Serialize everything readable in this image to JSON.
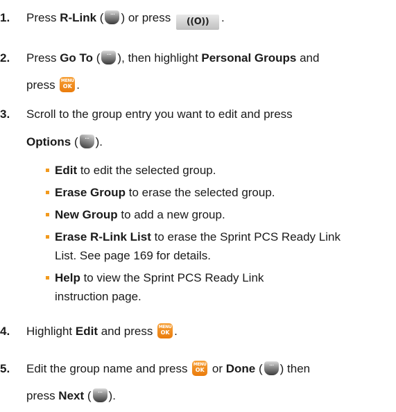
{
  "steps": [
    {
      "number": "1.",
      "text_a": "Press ",
      "bold_a": "R-Link",
      "text_b": " (",
      "text_c": ") or press ",
      "text_d": "."
    },
    {
      "number": "2.",
      "text_a": "Press ",
      "bold_a": "Go To",
      "text_b": " (",
      "text_c": "), then highlight ",
      "bold_b": "Personal Groups",
      "text_d": " and",
      "line2": "press ",
      "text_e": "."
    },
    {
      "number": "3.",
      "text_a": "Scroll to the group entry you want to edit and press",
      "bold_a": "Options",
      "text_b": " (",
      "text_c": ")."
    },
    {
      "number": "4.",
      "text_a": "Highlight ",
      "bold_a": "Edit",
      "text_b": " and press ",
      "text_c": "."
    },
    {
      "number": "5.",
      "text_a": "Edit the group name and press ",
      "text_b": " or ",
      "bold_a": "Done",
      "text_c": " (",
      "text_d": ") then",
      "line2": "press ",
      "bold_b": "Next",
      "text_e": " (",
      "text_f": ")."
    }
  ],
  "options": [
    {
      "label": "Edit",
      "desc": " to edit the selected group."
    },
    {
      "label": "Erase Group",
      "desc": " to erase the selected group."
    },
    {
      "label": "New Group",
      "desc": " to add a new group."
    },
    {
      "label": "Erase R-Link List",
      "desc": " to erase the Sprint PCS Ready Link",
      "desc2": "List. See page 169 for details."
    },
    {
      "label": "Help",
      "desc": " to view the Sprint PCS Ready Link",
      "desc2": "instruction page."
    }
  ],
  "keys": {
    "rlink_key": "((O))",
    "menu_top": "MENU",
    "menu_bottom": "OK"
  },
  "colors": {
    "bullet": "#f29a1e",
    "menu_key": "#ea7c0c"
  }
}
